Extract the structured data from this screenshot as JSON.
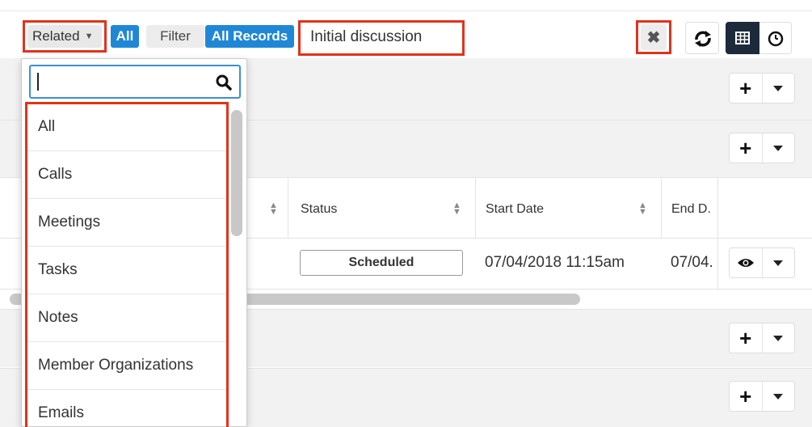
{
  "filter_bar": {
    "related_label": "Related",
    "all_label": "All",
    "filter_label": "Filter",
    "all_records_label": "All Records",
    "search_value": "Initial discussion",
    "clear_icon": "✖"
  },
  "dropdown": {
    "search_value": "",
    "items": [
      "All",
      "Calls",
      "Meetings",
      "Tasks",
      "Notes",
      "Member Organizations",
      "Emails"
    ]
  },
  "table": {
    "headers": {
      "status": "Status",
      "start_date": "Start Date",
      "end_date": "End D."
    },
    "row": {
      "status": "Scheduled",
      "start_date": "07/04/2018 11:15am",
      "end_date": "07/04."
    }
  },
  "colors": {
    "accent": "#1f87d6",
    "highlight": "#e2321a",
    "dark_button": "#1c2a3a"
  }
}
